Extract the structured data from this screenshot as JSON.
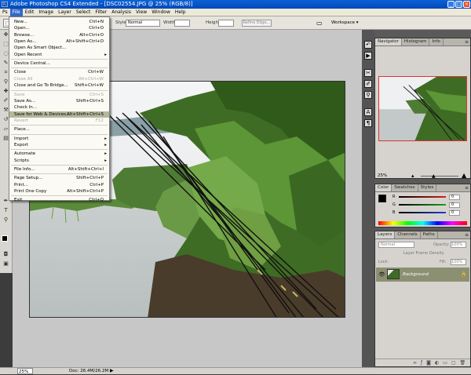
{
  "window": {
    "title": "Adobe Photoshop CS4 Extended - [DSC02554.JPG @ 25% (RGB/8)]",
    "app_icon": "Ps",
    "controls": [
      "_",
      "□",
      "×"
    ]
  },
  "menubar": {
    "items": [
      "Ps",
      "File",
      "Edit",
      "Image",
      "Layer",
      "Select",
      "Filter",
      "Analysis",
      "View",
      "Window",
      "Help"
    ],
    "open": "File"
  },
  "options_bar": {
    "style_label": "Style:",
    "style_value": "Normal",
    "width_label": "Width:",
    "height_label": "Height:",
    "refine_edge": "Refine Edge...",
    "workspace": "Workspace ▾"
  },
  "file_menu": {
    "items": [
      {
        "label": "New...",
        "shortcut": "Ctrl+N"
      },
      {
        "label": "Open...",
        "shortcut": "Ctrl+O"
      },
      {
        "label": "Browse...",
        "shortcut": "Alt+Ctrl+O"
      },
      {
        "label": "Open As...",
        "shortcut": "Alt+Shift+Ctrl+O"
      },
      {
        "label": "Open As Smart Object...",
        "shortcut": ""
      },
      {
        "label": "Open Recent",
        "shortcut": "",
        "submenu": true
      },
      {
        "label": "Device Central...",
        "shortcut": ""
      },
      {
        "label": "Close",
        "shortcut": "Ctrl+W"
      },
      {
        "label": "Close All",
        "shortcut": "Alt+Ctrl+W",
        "disabled": true
      },
      {
        "label": "Close and Go To Bridge...",
        "shortcut": "Shift+Ctrl+W"
      },
      {
        "label": "Save",
        "shortcut": "Ctrl+S",
        "disabled": true
      },
      {
        "label": "Save As...",
        "shortcut": "Shift+Ctrl+S"
      },
      {
        "label": "Check In...",
        "shortcut": ""
      },
      {
        "label": "Save for Web & Devices...",
        "shortcut": "Alt+Shift+Ctrl+S",
        "highlighted": true
      },
      {
        "label": "Revert",
        "shortcut": "F12",
        "disabled": true
      },
      {
        "label": "Place...",
        "shortcut": ""
      },
      {
        "label": "Import",
        "shortcut": "",
        "submenu": true
      },
      {
        "label": "Export",
        "shortcut": "",
        "submenu": true
      },
      {
        "label": "Automate",
        "shortcut": "",
        "submenu": true
      },
      {
        "label": "Scripts",
        "shortcut": "",
        "submenu": true
      },
      {
        "label": "File Info...",
        "shortcut": "Alt+Shift+Ctrl+I"
      },
      {
        "label": "Page Setup...",
        "shortcut": "Shift+Ctrl+P"
      },
      {
        "label": "Print...",
        "shortcut": "Ctrl+P"
      },
      {
        "label": "Print One Copy",
        "shortcut": "Alt+Shift+Ctrl+P"
      },
      {
        "label": "Exit",
        "shortcut": "Ctrl+Q"
      }
    ]
  },
  "navigator": {
    "tabs": [
      "Navigator",
      "Histogram",
      "Info"
    ],
    "zoom": "25%"
  },
  "color_panel": {
    "tabs": [
      "Color",
      "Swatches",
      "Styles"
    ],
    "channels": [
      {
        "name": "R",
        "value": "0",
        "color": "#d81e1e"
      },
      {
        "name": "G",
        "value": "0",
        "color": "#1ea01e"
      },
      {
        "name": "B",
        "value": "0",
        "color": "#1e3cd8"
      }
    ]
  },
  "layers_panel": {
    "tabs": [
      "Layers",
      "Channels",
      "Paths"
    ],
    "blend_mode": "Normal",
    "opacity_label": "Opacity:",
    "opacity_value": "100%",
    "unify_label": "Layer Frame Density",
    "lock_label": "Lock:",
    "fill_label": "Fill:",
    "fill_value": "100%",
    "layer_name": "Background"
  },
  "status_bar": {
    "zoom": "25%",
    "doc": "Doc: 26.4M/26.2M"
  },
  "colors": {
    "menu_highlight": "#b4b89a",
    "layer_selected": "#8b9072",
    "title_bar": "#0b62d6"
  }
}
